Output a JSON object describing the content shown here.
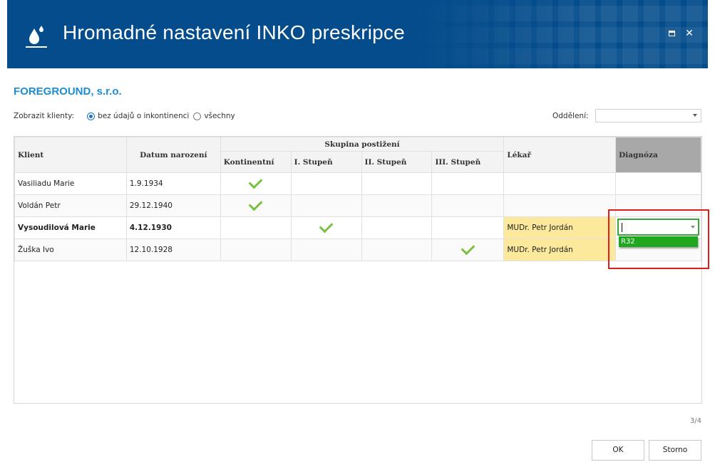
{
  "window": {
    "title": "Hromadné nastavení INKO preskripce",
    "maximize_icon": "maximize-icon",
    "close_symbol": "✕"
  },
  "company": "FOREGROUND, s.r.o.",
  "filter": {
    "label": "Zobrazit klienty:",
    "options": [
      {
        "label": "bez údajů o inkontinenci",
        "checked": true
      },
      {
        "label": "všechny",
        "checked": false
      }
    ]
  },
  "department": {
    "label": "Oddělení:",
    "value": ""
  },
  "table": {
    "headers": {
      "client": "Klient",
      "birth": "Datum narození",
      "group": "Skupina postižení",
      "continent": "Kontinentní",
      "stage1": "I. Stupeň",
      "stage2": "II. Stupeň",
      "stage3": "III. Stupeň",
      "doctor": "Lékař",
      "diagnosis": "Diagnóza"
    },
    "rows": [
      {
        "client": "Vasiliadu Marie",
        "birth": "1.9.1934",
        "group": "continent",
        "doctor": "",
        "diagnosis": ""
      },
      {
        "client": "Voldán Petr",
        "birth": "29.12.1940",
        "group": "continent",
        "doctor": "",
        "diagnosis": ""
      },
      {
        "client": "Vysoudilová Marie",
        "birth": "4.12.1930",
        "group": "stage1",
        "doctor": "MUDr. Petr Jordán",
        "diagnosis": ""
      },
      {
        "client": "Žuška Ivo",
        "birth": "12.10.1928",
        "group": "stage3",
        "doctor": "MUDr. Petr Jordán",
        "diagnosis": ""
      }
    ]
  },
  "diagnosis_editor": {
    "value": "",
    "dropdown_option": "R32"
  },
  "pager": "3/4",
  "buttons": {
    "ok": "OK",
    "cancel": "Storno"
  },
  "colors": {
    "titlebar": "#044c8c",
    "company": "#1a8dd6",
    "check": "#7ac143",
    "doctor_cell": "#fde99b",
    "editor_border": "#3aa33a",
    "dropdown": "#1fa81f",
    "highlight": "#e01d1d"
  }
}
